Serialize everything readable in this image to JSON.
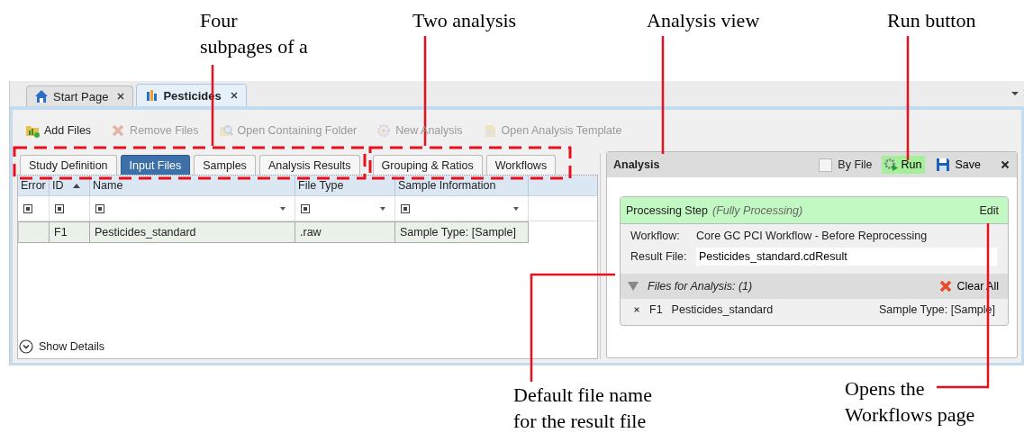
{
  "callouts": [
    {
      "text": "Four\nsubpages of a"
    },
    {
      "text": "Two analysis"
    },
    {
      "text": "Analysis view"
    },
    {
      "text": "Run button"
    },
    {
      "text": "Default file name\nfor the result file"
    },
    {
      "text": "Opens the\nWorkflows page"
    }
  ],
  "doc_tabs": [
    {
      "label": "Start Page",
      "kind": "home",
      "selected": false
    },
    {
      "label": "Pesticides",
      "kind": "chart",
      "selected": true
    }
  ],
  "toolbar": [
    {
      "label": "Add Files",
      "kind": "add",
      "disabled": false
    },
    {
      "label": "Remove Files",
      "kind": "remove",
      "disabled": true
    },
    {
      "label": "Open Containing Folder",
      "kind": "folder",
      "disabled": true
    },
    {
      "label": "New Analysis",
      "kind": "gear",
      "disabled": true
    },
    {
      "label": "Open Analysis Template",
      "kind": "template",
      "disabled": true
    }
  ],
  "subpage_tabs": [
    {
      "label": "Study Definition",
      "selected": false
    },
    {
      "label": "Input Files",
      "selected": true
    },
    {
      "label": "Samples",
      "selected": false
    },
    {
      "label": "Analysis Results",
      "selected": false
    },
    {
      "label": "Grouping & Ratios",
      "selected": false
    },
    {
      "label": "Workflows",
      "selected": false
    }
  ],
  "table": {
    "columns": [
      {
        "label": "Error",
        "sorted": false,
        "dropdown": false
      },
      {
        "label": "ID",
        "sorted": true,
        "dropdown": false
      },
      {
        "label": "Name",
        "sorted": false,
        "dropdown": true
      },
      {
        "label": "File Type",
        "sorted": false,
        "dropdown": true
      },
      {
        "label": "Sample Information",
        "sorted": false,
        "dropdown": true
      }
    ],
    "rows": [
      {
        "selected": true,
        "cells": [
          null,
          "F1",
          "Pesticides_standard",
          ".raw",
          "Sample Type: [Sample]"
        ]
      }
    ]
  },
  "show_details": {
    "label": "Show Details",
    "expanded": false
  },
  "analysis": {
    "title": "Analysis",
    "by_file": {
      "label": "By File",
      "checked": false
    },
    "run": "Run",
    "save": "Save",
    "step": {
      "title": "Processing Step",
      "subtitle": "(Fully Processing)",
      "edit": "Edit",
      "workflow_label": "Workflow:",
      "workflow": "Core GC PCI Workflow - Before Reprocessing",
      "result_label": "Result File:",
      "result_file": "Pesticides_standard.cdResult"
    },
    "files": {
      "title": "Files for Analysis: (1)",
      "expanded": true,
      "clear_all": "Clear All",
      "items": [
        {
          "id": "F1",
          "name": "Pesticides_standard",
          "info": "Sample Type: [Sample]"
        }
      ]
    }
  }
}
